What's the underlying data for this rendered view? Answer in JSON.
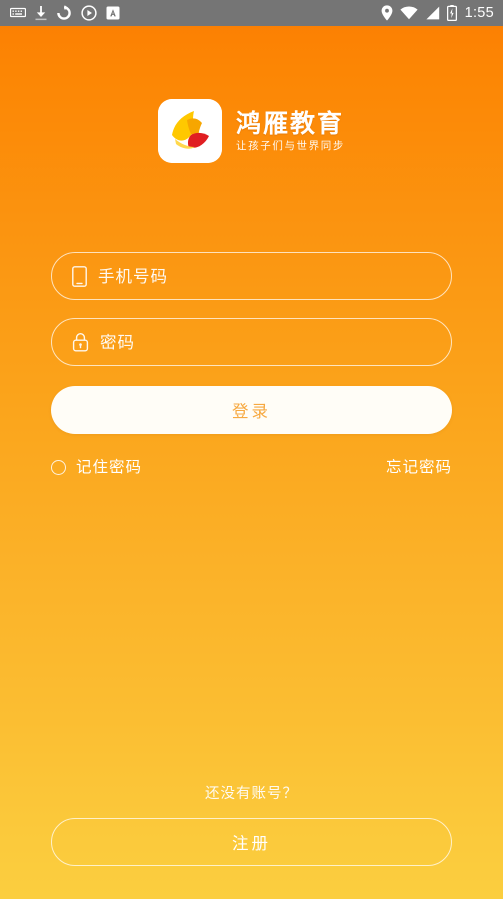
{
  "status_bar": {
    "background_color": "#757575",
    "clock": "1:55",
    "left_icons": [
      {
        "name": "keyboard-icon",
        "glyph": "keyboard"
      },
      {
        "name": "download-icon",
        "glyph": "download"
      },
      {
        "name": "sync-icon",
        "glyph": "sync"
      },
      {
        "name": "play-circle-icon",
        "glyph": "play-circle"
      },
      {
        "name": "app-badge-icon",
        "glyph": "letter-a"
      }
    ],
    "right_icons": [
      {
        "name": "location-icon",
        "glyph": "location-pin"
      },
      {
        "name": "wifi-icon",
        "glyph": "wifi"
      },
      {
        "name": "cellular-signal-icon",
        "glyph": "signal-triangle"
      },
      {
        "name": "battery-icon",
        "glyph": "battery"
      }
    ]
  },
  "theme": {
    "gradient_top": "#FB7D02",
    "gradient_mid": "#FBA41B",
    "gradient_bottom": "#FBCE3F",
    "button_text_color": "#F7A941",
    "field_text_color": "#FFFFFF"
  },
  "branding": {
    "logo_alt": "app-logo",
    "name": "鸿雁教育",
    "tagline": "让孩子们与世界同步"
  },
  "login_form": {
    "phone": {
      "icon": "mobile-phone-icon",
      "placeholder": "手机号码",
      "value": ""
    },
    "password": {
      "icon": "lock-icon",
      "placeholder": "密码",
      "value": ""
    },
    "login_label": "登录",
    "remember_label": "记住密码",
    "remember_checked": false,
    "forgot_label": "忘记密码"
  },
  "footer": {
    "no_account_text": "还没有账号？",
    "register_label": "注册"
  }
}
